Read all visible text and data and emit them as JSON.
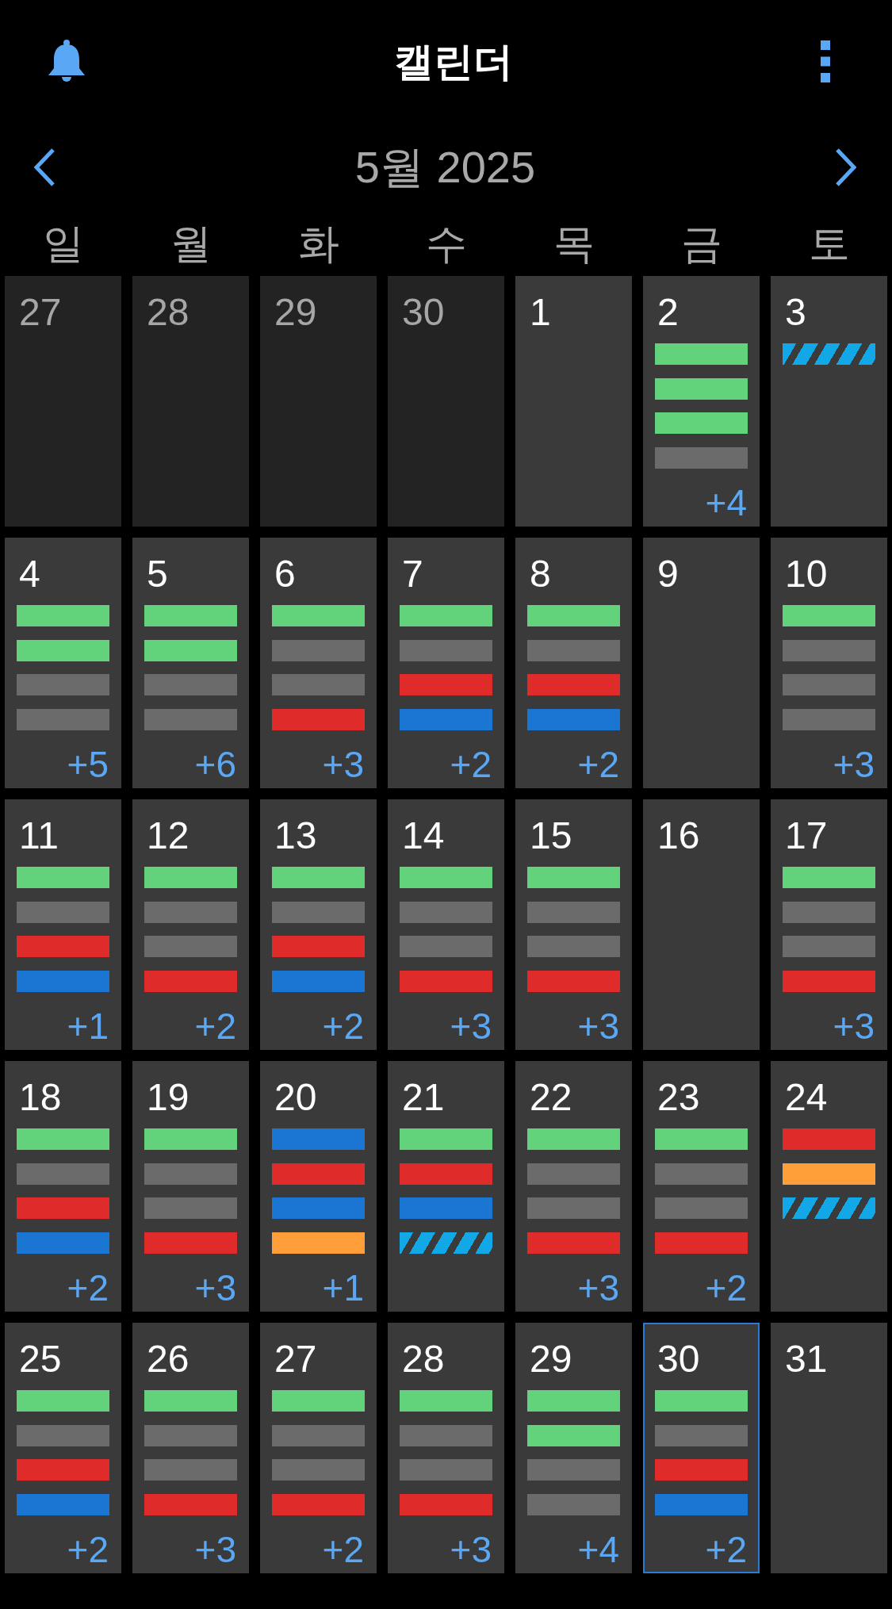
{
  "header": {
    "title": "캘린더"
  },
  "month_nav": {
    "label": "5월 2025"
  },
  "weekdays": [
    "일",
    "월",
    "화",
    "수",
    "목",
    "금",
    "토"
  ],
  "weeks": [
    {
      "days": [
        {
          "date": "27",
          "in_month": false,
          "selected": false
        },
        {
          "date": "28",
          "in_month": false,
          "selected": false
        },
        {
          "date": "29",
          "in_month": false,
          "selected": false
        },
        {
          "date": "30",
          "in_month": false,
          "selected": false
        },
        {
          "date": "1",
          "in_month": true,
          "selected": false
        },
        {
          "date": "2",
          "in_month": true,
          "selected": false,
          "events": [
            {
              "kind": "solid",
              "color": "#62d37a"
            },
            {
              "kind": "solid",
              "color": "#62d37a"
            },
            {
              "kind": "solid",
              "color": "#62d37a"
            },
            {
              "kind": "solid",
              "color": "#6b6b6b"
            }
          ],
          "more": "+4"
        },
        {
          "date": "3",
          "in_month": true,
          "selected": false,
          "events": [
            {
              "kind": "striped",
              "color": "#12a8e8"
            }
          ]
        }
      ]
    },
    {
      "days": [
        {
          "date": "4",
          "in_month": true,
          "selected": false,
          "events": [
            {
              "kind": "solid",
              "color": "#62d37a"
            },
            {
              "kind": "solid",
              "color": "#62d37a"
            },
            {
              "kind": "solid",
              "color": "#6b6b6b"
            },
            {
              "kind": "solid",
              "color": "#6b6b6b"
            }
          ],
          "more": "+5"
        },
        {
          "date": "5",
          "in_month": true,
          "selected": false,
          "events": [
            {
              "kind": "solid",
              "color": "#62d37a"
            },
            {
              "kind": "solid",
              "color": "#62d37a"
            },
            {
              "kind": "solid",
              "color": "#6b6b6b"
            },
            {
              "kind": "solid",
              "color": "#6b6b6b"
            }
          ],
          "more": "+6"
        },
        {
          "date": "6",
          "in_month": true,
          "selected": false,
          "events": [
            {
              "kind": "solid",
              "color": "#62d37a"
            },
            {
              "kind": "solid",
              "color": "#6b6b6b"
            },
            {
              "kind": "solid",
              "color": "#6b6b6b"
            },
            {
              "kind": "solid",
              "color": "#e02b2b"
            }
          ],
          "more": "+3"
        },
        {
          "date": "7",
          "in_month": true,
          "selected": false,
          "events": [
            {
              "kind": "solid",
              "color": "#62d37a"
            },
            {
              "kind": "solid",
              "color": "#6b6b6b"
            },
            {
              "kind": "solid",
              "color": "#e02b2b"
            },
            {
              "kind": "solid",
              "color": "#1a76d2"
            }
          ],
          "more": "+2"
        },
        {
          "date": "8",
          "in_month": true,
          "selected": false,
          "events": [
            {
              "kind": "solid",
              "color": "#62d37a"
            },
            {
              "kind": "solid",
              "color": "#6b6b6b"
            },
            {
              "kind": "solid",
              "color": "#e02b2b"
            },
            {
              "kind": "solid",
              "color": "#1a76d2"
            }
          ],
          "more": "+2"
        },
        {
          "date": "9",
          "in_month": true,
          "selected": false
        },
        {
          "date": "10",
          "in_month": true,
          "selected": false,
          "events": [
            {
              "kind": "solid",
              "color": "#62d37a"
            },
            {
              "kind": "solid",
              "color": "#6b6b6b"
            },
            {
              "kind": "solid",
              "color": "#6b6b6b"
            },
            {
              "kind": "solid",
              "color": "#6b6b6b"
            }
          ],
          "more": "+3"
        }
      ]
    },
    {
      "days": [
        {
          "date": "11",
          "in_month": true,
          "selected": false,
          "events": [
            {
              "kind": "solid",
              "color": "#62d37a"
            },
            {
              "kind": "solid",
              "color": "#6b6b6b"
            },
            {
              "kind": "solid",
              "color": "#e02b2b"
            },
            {
              "kind": "solid",
              "color": "#1a76d2"
            }
          ],
          "more": "+1"
        },
        {
          "date": "12",
          "in_month": true,
          "selected": false,
          "events": [
            {
              "kind": "solid",
              "color": "#62d37a"
            },
            {
              "kind": "solid",
              "color": "#6b6b6b"
            },
            {
              "kind": "solid",
              "color": "#6b6b6b"
            },
            {
              "kind": "solid",
              "color": "#e02b2b"
            }
          ],
          "more": "+2"
        },
        {
          "date": "13",
          "in_month": true,
          "selected": false,
          "events": [
            {
              "kind": "solid",
              "color": "#62d37a"
            },
            {
              "kind": "solid",
              "color": "#6b6b6b"
            },
            {
              "kind": "solid",
              "color": "#e02b2b"
            },
            {
              "kind": "solid",
              "color": "#1a76d2"
            }
          ],
          "more": "+2"
        },
        {
          "date": "14",
          "in_month": true,
          "selected": false,
          "events": [
            {
              "kind": "solid",
              "color": "#62d37a"
            },
            {
              "kind": "solid",
              "color": "#6b6b6b"
            },
            {
              "kind": "solid",
              "color": "#6b6b6b"
            },
            {
              "kind": "solid",
              "color": "#e02b2b"
            }
          ],
          "more": "+3"
        },
        {
          "date": "15",
          "in_month": true,
          "selected": false,
          "events": [
            {
              "kind": "solid",
              "color": "#62d37a"
            },
            {
              "kind": "solid",
              "color": "#6b6b6b"
            },
            {
              "kind": "solid",
              "color": "#6b6b6b"
            },
            {
              "kind": "solid",
              "color": "#e02b2b"
            }
          ],
          "more": "+3"
        },
        {
          "date": "16",
          "in_month": true,
          "selected": false
        },
        {
          "date": "17",
          "in_month": true,
          "selected": false,
          "events": [
            {
              "kind": "solid",
              "color": "#62d37a"
            },
            {
              "kind": "solid",
              "color": "#6b6b6b"
            },
            {
              "kind": "solid",
              "color": "#6b6b6b"
            },
            {
              "kind": "solid",
              "color": "#e02b2b"
            }
          ],
          "more": "+3"
        }
      ]
    },
    {
      "days": [
        {
          "date": "18",
          "in_month": true,
          "selected": false,
          "events": [
            {
              "kind": "solid",
              "color": "#62d37a"
            },
            {
              "kind": "solid",
              "color": "#6b6b6b"
            },
            {
              "kind": "solid",
              "color": "#e02b2b"
            },
            {
              "kind": "solid",
              "color": "#1a76d2"
            }
          ],
          "more": "+2"
        },
        {
          "date": "19",
          "in_month": true,
          "selected": false,
          "events": [
            {
              "kind": "solid",
              "color": "#62d37a"
            },
            {
              "kind": "solid",
              "color": "#6b6b6b"
            },
            {
              "kind": "solid",
              "color": "#6b6b6b"
            },
            {
              "kind": "solid",
              "color": "#e02b2b"
            }
          ],
          "more": "+3"
        },
        {
          "date": "20",
          "in_month": true,
          "selected": false,
          "events": [
            {
              "kind": "solid",
              "color": "#1a76d2"
            },
            {
              "kind": "solid",
              "color": "#e02b2b"
            },
            {
              "kind": "solid",
              "color": "#1a76d2"
            },
            {
              "kind": "solid",
              "color": "#ff9f3a"
            }
          ],
          "more": "+1"
        },
        {
          "date": "21",
          "in_month": true,
          "selected": false,
          "events": [
            {
              "kind": "solid",
              "color": "#62d37a"
            },
            {
              "kind": "solid",
              "color": "#e02b2b"
            },
            {
              "kind": "solid",
              "color": "#1a76d2"
            },
            {
              "kind": "striped",
              "color": "#12a8e8"
            }
          ]
        },
        {
          "date": "22",
          "in_month": true,
          "selected": false,
          "events": [
            {
              "kind": "solid",
              "color": "#62d37a"
            },
            {
              "kind": "solid",
              "color": "#6b6b6b"
            },
            {
              "kind": "solid",
              "color": "#6b6b6b"
            },
            {
              "kind": "solid",
              "color": "#e02b2b"
            }
          ],
          "more": "+3"
        },
        {
          "date": "23",
          "in_month": true,
          "selected": false,
          "events": [
            {
              "kind": "solid",
              "color": "#62d37a"
            },
            {
              "kind": "solid",
              "color": "#6b6b6b"
            },
            {
              "kind": "solid",
              "color": "#6b6b6b"
            },
            {
              "kind": "solid",
              "color": "#e02b2b"
            }
          ],
          "more": "+2"
        },
        {
          "date": "24",
          "in_month": true,
          "selected": false,
          "events": [
            {
              "kind": "solid",
              "color": "#e02b2b"
            },
            {
              "kind": "solid",
              "color": "#ff9f3a"
            },
            {
              "kind": "striped",
              "color": "#12a8e8"
            }
          ]
        }
      ]
    },
    {
      "days": [
        {
          "date": "25",
          "in_month": true,
          "selected": false,
          "events": [
            {
              "kind": "solid",
              "color": "#62d37a"
            },
            {
              "kind": "solid",
              "color": "#6b6b6b"
            },
            {
              "kind": "solid",
              "color": "#e02b2b"
            },
            {
              "kind": "solid",
              "color": "#1a76d2"
            }
          ],
          "more": "+2"
        },
        {
          "date": "26",
          "in_month": true,
          "selected": false,
          "events": [
            {
              "kind": "solid",
              "color": "#62d37a"
            },
            {
              "kind": "solid",
              "color": "#6b6b6b"
            },
            {
              "kind": "solid",
              "color": "#6b6b6b"
            },
            {
              "kind": "solid",
              "color": "#e02b2b"
            }
          ],
          "more": "+3"
        },
        {
          "date": "27",
          "in_month": true,
          "selected": false,
          "events": [
            {
              "kind": "solid",
              "color": "#62d37a"
            },
            {
              "kind": "solid",
              "color": "#6b6b6b"
            },
            {
              "kind": "solid",
              "color": "#6b6b6b"
            },
            {
              "kind": "solid",
              "color": "#e02b2b"
            }
          ],
          "more": "+2"
        },
        {
          "date": "28",
          "in_month": true,
          "selected": false,
          "events": [
            {
              "kind": "solid",
              "color": "#62d37a"
            },
            {
              "kind": "solid",
              "color": "#6b6b6b"
            },
            {
              "kind": "solid",
              "color": "#6b6b6b"
            },
            {
              "kind": "solid",
              "color": "#e02b2b"
            }
          ],
          "more": "+3"
        },
        {
          "date": "29",
          "in_month": true,
          "selected": false,
          "events": [
            {
              "kind": "solid",
              "color": "#62d37a"
            },
            {
              "kind": "solid",
              "color": "#62d37a"
            },
            {
              "kind": "solid",
              "color": "#6b6b6b"
            },
            {
              "kind": "solid",
              "color": "#6b6b6b"
            }
          ],
          "more": "+4"
        },
        {
          "date": "30",
          "in_month": true,
          "selected": true,
          "events": [
            {
              "kind": "solid",
              "color": "#62d37a"
            },
            {
              "kind": "solid",
              "color": "#6b6b6b"
            },
            {
              "kind": "solid",
              "color": "#e02b2b"
            },
            {
              "kind": "solid",
              "color": "#1a76d2"
            }
          ],
          "more": "+2"
        },
        {
          "date": "31",
          "in_month": true,
          "selected": false
        }
      ]
    }
  ]
}
